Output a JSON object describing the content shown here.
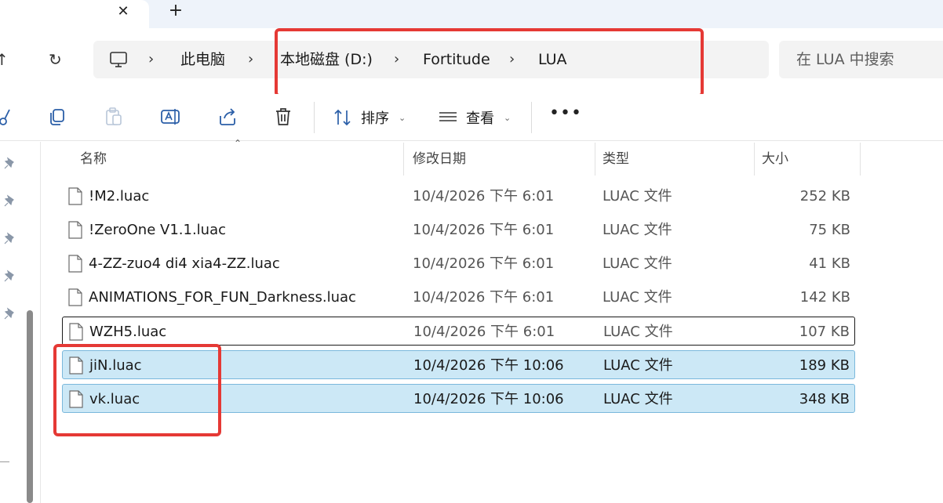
{
  "tabs": {
    "close_glyph": "✕",
    "new_tab_glyph": "+"
  },
  "nav": {
    "back_glyph": "↑",
    "refresh_glyph": "↻",
    "breadcrumb": [
      "此电脑",
      "本地磁盘 (D:)",
      "Fortitude",
      "LUA"
    ],
    "separator": "›",
    "search_placeholder": "在 LUA 中搜索"
  },
  "toolbar": {
    "icons": [
      "cut-icon",
      "copy-icon",
      "paste-icon",
      "rename-icon",
      "share-icon",
      "delete-icon"
    ],
    "sort_label": "排序",
    "view_label": "查看",
    "caret": "⌄",
    "more_label": "•••"
  },
  "columns": {
    "name": "名称",
    "date": "修改日期",
    "type": "类型",
    "size": "大小"
  },
  "files": [
    {
      "name": "!M2.luac",
      "date": "10/4/2026 下午 6:01",
      "type": "LUAC 文件",
      "size": "252 KB",
      "state": "normal"
    },
    {
      "name": "!ZeroOne V1.1.luac",
      "date": "10/4/2026 下午 6:01",
      "type": "LUAC 文件",
      "size": "75 KB",
      "state": "normal"
    },
    {
      "name": "4-ZZ-zuo4 di4 xia4-ZZ.luac",
      "date": "10/4/2026 下午 6:01",
      "type": "LUAC 文件",
      "size": "41 KB",
      "state": "normal"
    },
    {
      "name": "ANIMATIONS_FOR_FUN_Darkness.luac",
      "date": "10/4/2026 下午 6:01",
      "type": "LUAC 文件",
      "size": "142 KB",
      "state": "normal"
    },
    {
      "name": "WZH5.luac",
      "date": "10/4/2026 下午 6:01",
      "type": "LUAC 文件",
      "size": "107 KB",
      "state": "focused"
    },
    {
      "name": "jiN.luac",
      "date": "10/4/2026 下午 10:06",
      "type": "LUAC 文件",
      "size": "189 KB",
      "state": "selected"
    },
    {
      "name": "vk.luac",
      "date": "10/4/2026 下午 10:06",
      "type": "LUAC 文件",
      "size": "348 KB",
      "state": "selected"
    }
  ],
  "colors": {
    "selection": "#cce8f6",
    "highlight_box": "#e53935"
  }
}
